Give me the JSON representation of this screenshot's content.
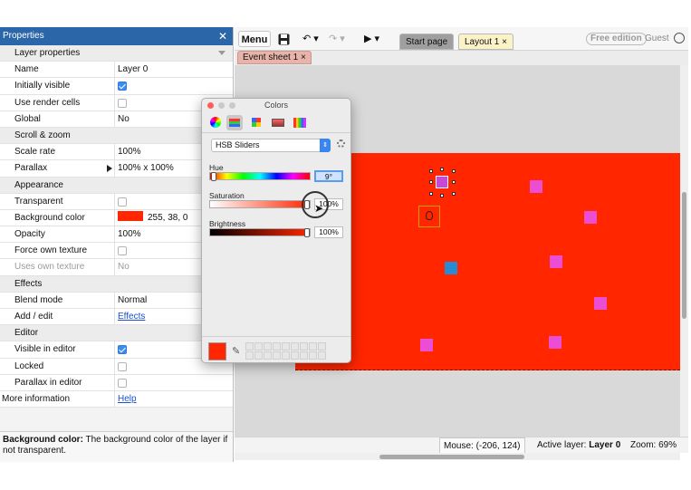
{
  "properties": {
    "title": "Properties",
    "rows": [
      {
        "label": "Layer properties",
        "kind": "section"
      },
      {
        "label": "Name",
        "value": "Layer 0"
      },
      {
        "label": "Initially visible",
        "check": true
      },
      {
        "label": "Use render cells",
        "check": false
      },
      {
        "label": "Global",
        "value": "No"
      },
      {
        "label": "Scroll & zoom",
        "kind": "section"
      },
      {
        "label": "Scale rate",
        "value": "100%"
      },
      {
        "label": "Parallax",
        "value": "100% x 100%",
        "expand": true
      },
      {
        "label": "Appearance",
        "kind": "section"
      },
      {
        "label": "Transparent",
        "check": false
      },
      {
        "label": "Background color",
        "value": "255, 38, 0",
        "swatch": "#ff2600"
      },
      {
        "label": "Opacity",
        "value": "100%"
      },
      {
        "label": "Force own texture",
        "check": false
      },
      {
        "label": "Uses own texture",
        "value": "No",
        "dim": true
      },
      {
        "label": "Effects",
        "kind": "section"
      },
      {
        "label": "Blend mode",
        "value": "Normal"
      },
      {
        "label": "Add / edit",
        "value": "Effects",
        "link": true
      },
      {
        "label": "Editor",
        "kind": "section"
      },
      {
        "label": "Visible in editor",
        "check": true
      },
      {
        "label": "Locked",
        "check": false
      },
      {
        "label": "Parallax in editor",
        "check": false
      },
      {
        "label": "More information",
        "value": "Help",
        "link": true,
        "flush": true
      }
    ],
    "help_label": "Background color:",
    "help_text": " The background color of the layer if not transparent."
  },
  "toolbar": {
    "menu_label": "Menu",
    "save_icon": "💾",
    "undo_icon": "↶ ▾",
    "redo_icon": "↷ ▾",
    "play_icon": "▶ ▾",
    "tab_start_label": "Start page",
    "tab_layout_label": "Layout 1",
    "tab_close": "×",
    "free_edition": "Free edition",
    "guest": "Guest"
  },
  "sheet_tab_label": "Event sheet 1",
  "status": {
    "mouse": "Mouse: (-206, 124)",
    "active_layer_label": "Active layer:",
    "active_layer_value": "Layer 0",
    "zoom": "Zoom: 69%"
  },
  "colors_dialog": {
    "title": "Colors",
    "mode": "HSB Sliders",
    "hue_label": "Hue",
    "hue_value": "9°",
    "saturation_label": "Saturation",
    "saturation_value": "100%",
    "brightness_label": "Brightness",
    "brightness_value": "100%",
    "current_color": "#ff2600"
  },
  "layout": {
    "background_color": "#ff2600",
    "sprite_color": "#ec4dd5",
    "blue_sprite_color": "#2a8bd5"
  }
}
